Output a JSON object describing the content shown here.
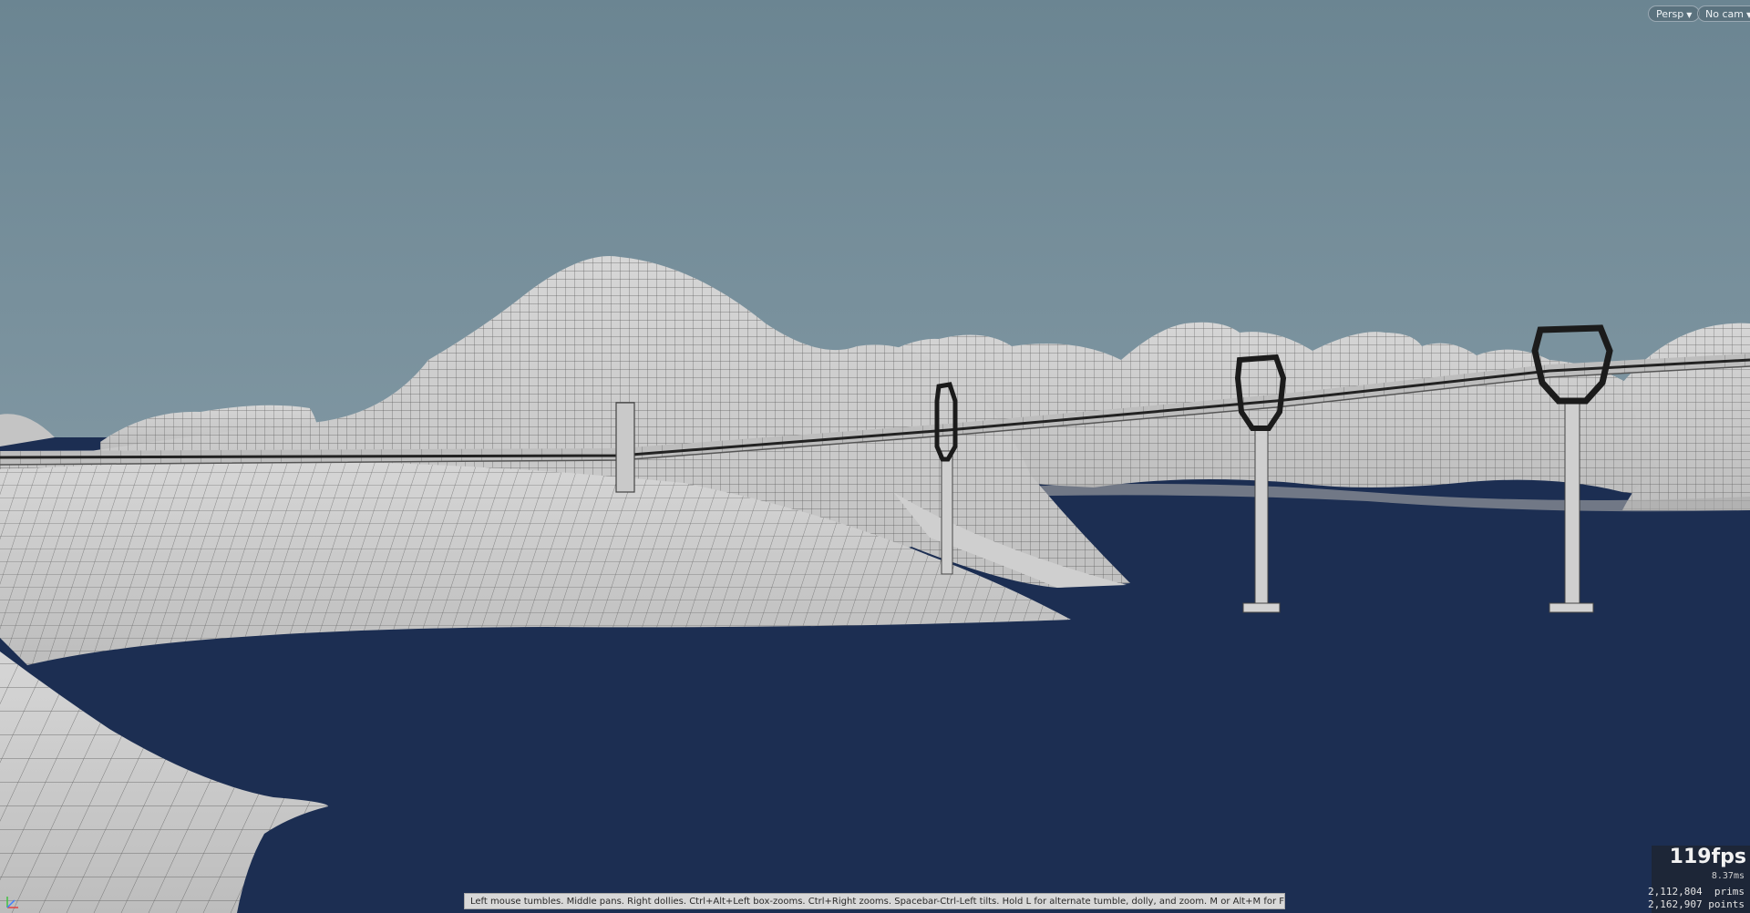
{
  "viewport": {
    "camera_menu_label": "Persp",
    "camera_select_label": "No cam",
    "hint_text": "Left mouse tumbles. Middle pans. Right dollies. Ctrl+Alt+Left box-zooms. Ctrl+Right zooms. Spacebar-Ctrl-Left tilts. Hold L for alternate tumble, dolly, and zoom.    M or Alt+M for First Person Navigation.",
    "stats": {
      "fps": "119fps",
      "frame_time": "8.37ms",
      "prims": "2,112,804  prims",
      "points": "2,162,907 points"
    }
  },
  "colors": {
    "sky_top": "#6b8592",
    "sky_bottom": "#8fa3ad",
    "water": "#1c2e52",
    "terrain": "#c6c6c6",
    "wireframe": "#4a4a4a",
    "pylon_ring": "#1b1b1b"
  },
  "icons": {
    "dropdown": "chevron-down-icon",
    "axis": "axis-gizmo-icon"
  }
}
